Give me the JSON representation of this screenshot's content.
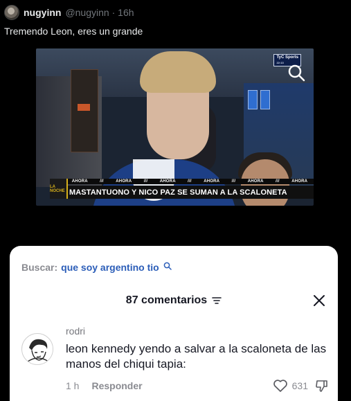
{
  "tweet": {
    "display_name": "nugyinn",
    "handle": "@nugyinn",
    "separator": "·",
    "age": "16h",
    "text": "Tremendo Leon, eres un grande"
  },
  "video": {
    "channel_badge": "TyC Sports",
    "badge_sub": "22:13",
    "ticker_word": "AHORA",
    "ticker_repeat": 6,
    "ticker_separator": "///",
    "headline": "MASTANTUONO Y NICO PAZ SE SUMAN A LA SCALONETA",
    "show_logo": "LA NOCHE"
  },
  "comments_panel": {
    "search_label": "Buscar:",
    "search_query": "que soy argentino tio",
    "count_label": "87 comentarios",
    "comment": {
      "username": "rodri",
      "text": "leon kennedy yendo a salvar a la scaloneta de las manos del chiqui tapia:",
      "time": "1 h",
      "reply_label": "Responder",
      "likes": "631"
    }
  },
  "colors": {
    "background": "#000000",
    "sheet": "#ffffff",
    "accent_query": "#2b5db8",
    "muted": "#8a8b91"
  },
  "icons": [
    "avatar",
    "magnifier-icon",
    "search-icon",
    "filter-icon",
    "close-icon",
    "heart-icon",
    "dislike-icon"
  ]
}
